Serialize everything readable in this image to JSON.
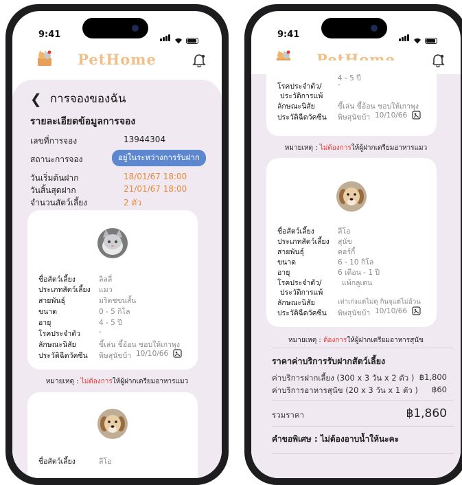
{
  "status_bar": {
    "time": "9:41"
  },
  "app": {
    "brand": "PetHome"
  },
  "booking": {
    "page_title": "การจองของฉัน",
    "section_title": "รายละเอียดข้อมูลการจอง",
    "booking_no_label": "เลขที่การจอง",
    "booking_no": "13944304",
    "status_label": "สถานะการจอง",
    "status": "อยู่ในระหว่างการรับฝาก",
    "start_label": "วันเริ่มต้นฝาก",
    "start": "18/01/67 18:00",
    "end_label": "วันสิ้นสุดฝาก",
    "end": "21/01/67 18:00",
    "pet_count_label": "จำนวนสัตว์เลี้ยง",
    "pet_count": "2 ตัว"
  },
  "labels": {
    "name": "ชื่อสัตว์เลี้ยง",
    "type": "ประเภทสัตว์เลี้ยง",
    "breed": "สายพันธุ์",
    "size": "ขนาด",
    "age": "อายุ",
    "disease": "โรคประจำตัว",
    "disease_line1": "โรคประจำตัว/",
    "disease_line2": "ประวัติการแพ้",
    "trait": "ลักษณะนิสัย",
    "vaccine": "ประวัติฉีดวัคซีน"
  },
  "cat": {
    "name": "ลิลลี่",
    "type": "แมว",
    "breed": "มริตชขนสั้น",
    "size": "0 - 5 กิโล",
    "age": "4 - 5 ปี",
    "disease": "-",
    "trait": "ขี้เล่น ขี้อ้อน ชอบให้เกาพุง",
    "vaccine": "พิษสุนัขบ้า",
    "vaccine_date": "10/10/66",
    "note_prefix": "หมายเหตุ : ",
    "note_highlight": "ไม่ต้องการ",
    "note_suffix": "ให้ผู้ฝากเตรียมอาหารแมว",
    "age_partial": "4 - 5 ปี"
  },
  "dog": {
    "name": "ลีโอ",
    "type": "สุนัข",
    "breed": "คอร์กี้",
    "size": "6 - 10 กิโล",
    "age": "6 เดือน - 1 ปี",
    "disease": "แพ้กลูเตน",
    "trait": "เห่าเก่งแต่ไม่ดุ กินจุแต่ไม่อ้วน",
    "vaccine": "พิษสุนัขบ้า",
    "vaccine_date": "10/10/66",
    "note_prefix": "หมายเหตุ : ",
    "note_highlight": "ต้องการ",
    "note_suffix": "ให้ผู้ฝากเตรียมอาหารสุนัข"
  },
  "pricing": {
    "title": "ราคาค่าบริการรับฝากสัตว์เลี้ยง",
    "rows": [
      {
        "label": "ค่าบริการฝากเลี้ยง (300 x 3 วัน x 2 ตัว )",
        "amount": "฿1,800"
      },
      {
        "label": "ค่าบริการอาหารสุนัข (20 x 3 วัน x 1 ตัว )",
        "amount": "฿60"
      }
    ],
    "total_label": "รวมราคา",
    "total": "฿1,860",
    "special_request": "คำขอพิเศษ : ไม่ต้องอาบน้ำให้นะคะ"
  },
  "colors": {
    "accent_blue": "#5d87cf",
    "orange": "#e58a3a",
    "red": "#e53935",
    "background_lilac": "#f1e9f1",
    "brand": "#f0c08a"
  }
}
